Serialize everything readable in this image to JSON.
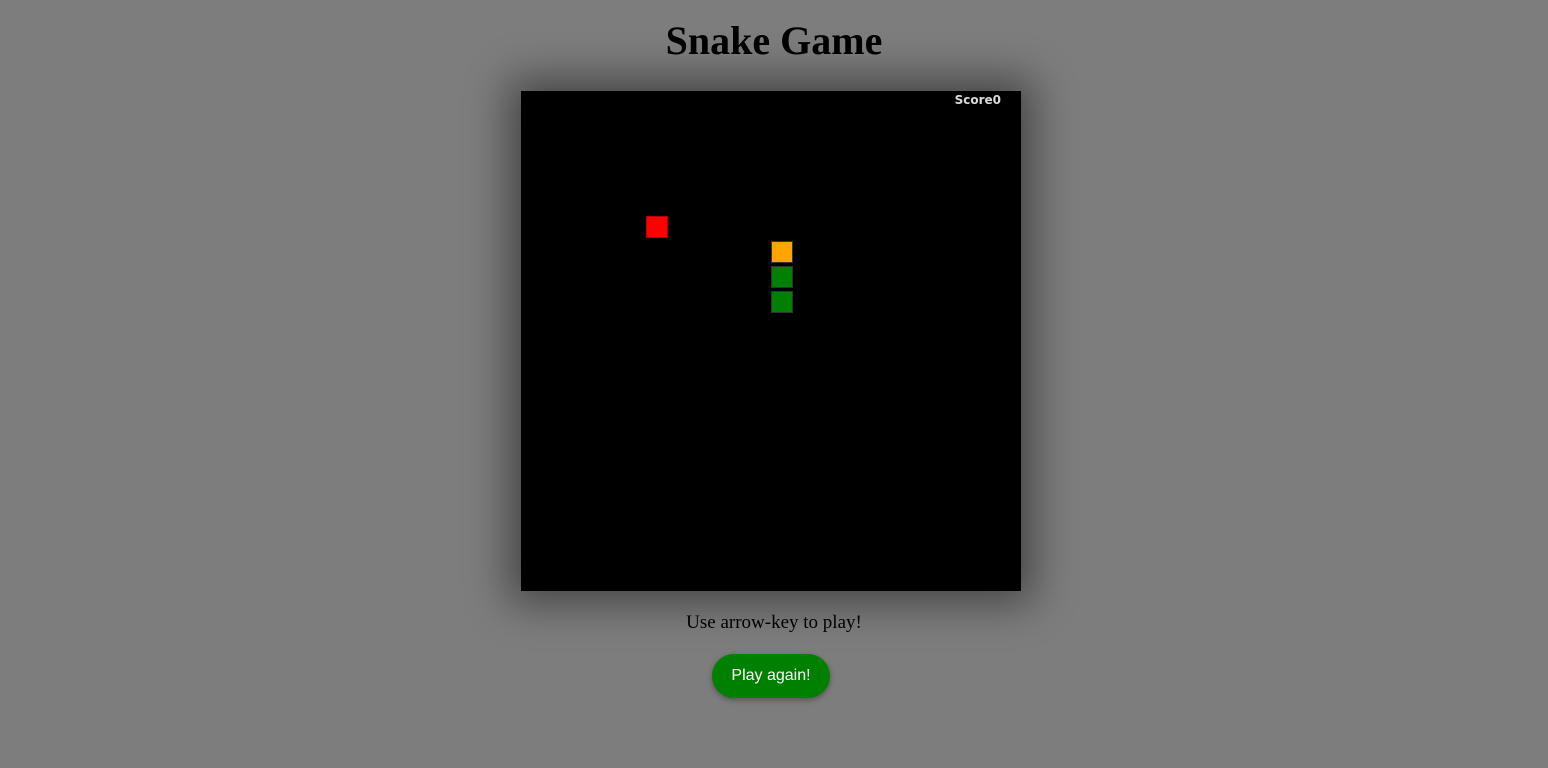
{
  "page": {
    "title": "Snake Game",
    "instructions": "Use arrow-key to play!",
    "play_again_label": "Play again!"
  },
  "board": {
    "score_label": "Score",
    "score_value": "0",
    "grid_columns": 20,
    "grid_rows": 20,
    "food": {
      "col": 5,
      "row": 5,
      "color": "#ff0000"
    },
    "snake": [
      {
        "col": 10,
        "row": 6,
        "part": "head",
        "color": "#ffa500"
      },
      {
        "col": 10,
        "row": 7,
        "part": "body",
        "color": "#008000"
      },
      {
        "col": 10,
        "row": 8,
        "part": "body",
        "color": "#008000"
      }
    ]
  },
  "colors": {
    "page_background": "#7d7d7d",
    "board_background": "#000000",
    "button_background": "#008000"
  }
}
